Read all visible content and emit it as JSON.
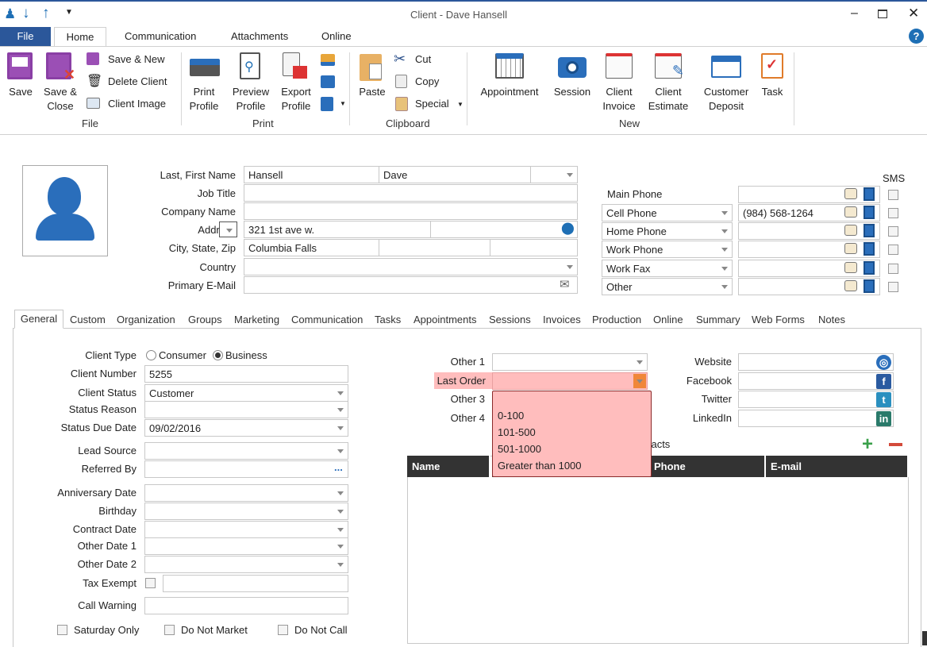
{
  "window": {
    "title": "Client - Dave Hansell"
  },
  "quick_access": [
    "user-icon",
    "arrow-down-icon",
    "arrow-up-icon",
    "customize-icon"
  ],
  "ribbon_tabs": [
    "File",
    "Home",
    "Communication",
    "Attachments",
    "Online"
  ],
  "ribbon": {
    "file": {
      "group": "File",
      "save": "Save",
      "save_close": [
        "Save &",
        "Close"
      ],
      "save_new": "Save & New",
      "delete_client": "Delete Client",
      "client_image": "Client Image"
    },
    "print": {
      "group": "Print",
      "print_profile": [
        "Print",
        "Profile"
      ],
      "preview_profile": [
        "Preview",
        "Profile"
      ],
      "export_profile": [
        "Export",
        "Profile"
      ]
    },
    "clipboard": {
      "group": "Clipboard",
      "paste": "Paste",
      "cut": "Cut",
      "copy": "Copy",
      "special": "Special"
    },
    "new": {
      "group": "New",
      "appointment": "Appointment",
      "session": "Session",
      "client_invoice": [
        "Client",
        "Invoice"
      ],
      "client_estimate": [
        "Client",
        "Estimate"
      ],
      "customer_deposit": [
        "Customer",
        "Deposit"
      ],
      "task": "Task"
    }
  },
  "header_form": {
    "labels": [
      "Last, First Name",
      "Job Title",
      "Company Name",
      "Address",
      "City, State, Zip",
      "Country",
      "Primary E-Mail"
    ],
    "last_name": "Hansell",
    "first_name": "Dave",
    "address": "321 1st ave w.",
    "city": "Columbia Falls",
    "sms_label": "SMS",
    "phones": [
      {
        "type": "Main Phone",
        "value": ""
      },
      {
        "type": "Cell Phone",
        "value": "(984) 568-1264"
      },
      {
        "type": "Home Phone",
        "value": ""
      },
      {
        "type": "Work Phone",
        "value": ""
      },
      {
        "type": "Work Fax",
        "value": ""
      },
      {
        "type": "Other",
        "value": ""
      }
    ]
  },
  "tabs": [
    "General",
    "Custom",
    "Organization",
    "Groups",
    "Marketing",
    "Communication",
    "Tasks",
    "Appointments",
    "Sessions",
    "Invoices",
    "Production",
    "Online",
    "Summary",
    "Web Forms",
    "Notes"
  ],
  "general": {
    "client_type_label": "Client Type",
    "client_type_options": [
      "Consumer",
      "Business"
    ],
    "client_type_selected": "Business",
    "fields": [
      {
        "label": "Client Number",
        "value": "5255"
      },
      {
        "label": "Client Status",
        "value": "Customer"
      },
      {
        "label": "Status Reason",
        "value": ""
      },
      {
        "label": "Status Due Date",
        "value": "09/02/2016"
      },
      {
        "label": "Lead Source",
        "value": ""
      },
      {
        "label": "Referred By",
        "value": ""
      },
      {
        "label": "Anniversary Date",
        "value": ""
      },
      {
        "label": "Birthday",
        "value": ""
      },
      {
        "label": "Contract Date",
        "value": ""
      },
      {
        "label": "Other Date 1",
        "value": ""
      },
      {
        "label": "Other Date 2",
        "value": ""
      },
      {
        "label": "Tax Exempt",
        "value": ""
      },
      {
        "label": "Call Warning",
        "value": ""
      }
    ],
    "checkboxes": [
      "Saturday Only",
      "Do Not Market",
      "Do Not Call"
    ],
    "other_labels": [
      "Other 1",
      "Last Order",
      "Other 3",
      "Other 4"
    ],
    "last_order_options": [
      "",
      "0-100",
      "101-500",
      "501-1000",
      "Greater than 1000"
    ],
    "social_labels": [
      "Website",
      "Facebook",
      "Twitter",
      "LinkedIn"
    ],
    "contacts_label": "Contacts",
    "contacts_columns": [
      "Name",
      "",
      "Phone",
      "E-mail"
    ]
  },
  "colors": {
    "file_tab": "#2b579a",
    "highlight": "#ffbdbd",
    "grid_header": "#333333",
    "accent": "#1e6fb5"
  }
}
